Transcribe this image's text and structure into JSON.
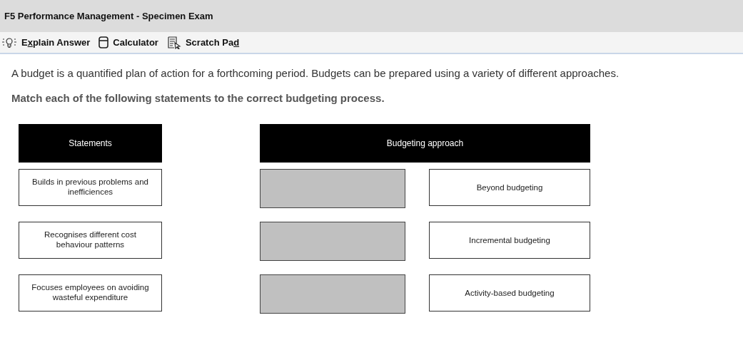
{
  "window": {
    "title": "F5 Performance Management - Specimen Exam"
  },
  "toolbar": [
    {
      "kind": "explain",
      "label_parts": [
        {
          "text": "E",
          "underlined": false
        },
        {
          "text": "x",
          "underlined": true
        },
        {
          "text": "plain Answer",
          "underlined": false
        }
      ]
    },
    {
      "kind": "calculator",
      "label_parts": [
        {
          "text": "Calculator",
          "underlined": false
        }
      ]
    },
    {
      "kind": "scratch",
      "label_parts": [
        {
          "text": "Scratch Pa",
          "underlined": false
        },
        {
          "text": "d",
          "underlined": true
        }
      ]
    }
  ],
  "intro": "A budget is a quantified plan of action for a forthcoming period. Budgets can be prepared using a variety of different approaches.",
  "instruction": "Match each of the following statements to the correct budgeting process.",
  "statements_header": "Statements",
  "approach_header": "Budgeting approach",
  "rows": [
    {
      "statement": "Builds in previous problems and inefficiences",
      "drop_zone": {
        "filled": false
      },
      "option": "Beyond budgeting"
    },
    {
      "statement": "Recognises different cost behaviour patterns",
      "drop_zone": {
        "filled": false
      },
      "option": "Incremental budgeting"
    },
    {
      "statement": "Focuses employees on avoiding wasteful expenditure",
      "drop_zone": {
        "filled": false
      },
      "option": "Activity-based budgeting"
    }
  ]
}
